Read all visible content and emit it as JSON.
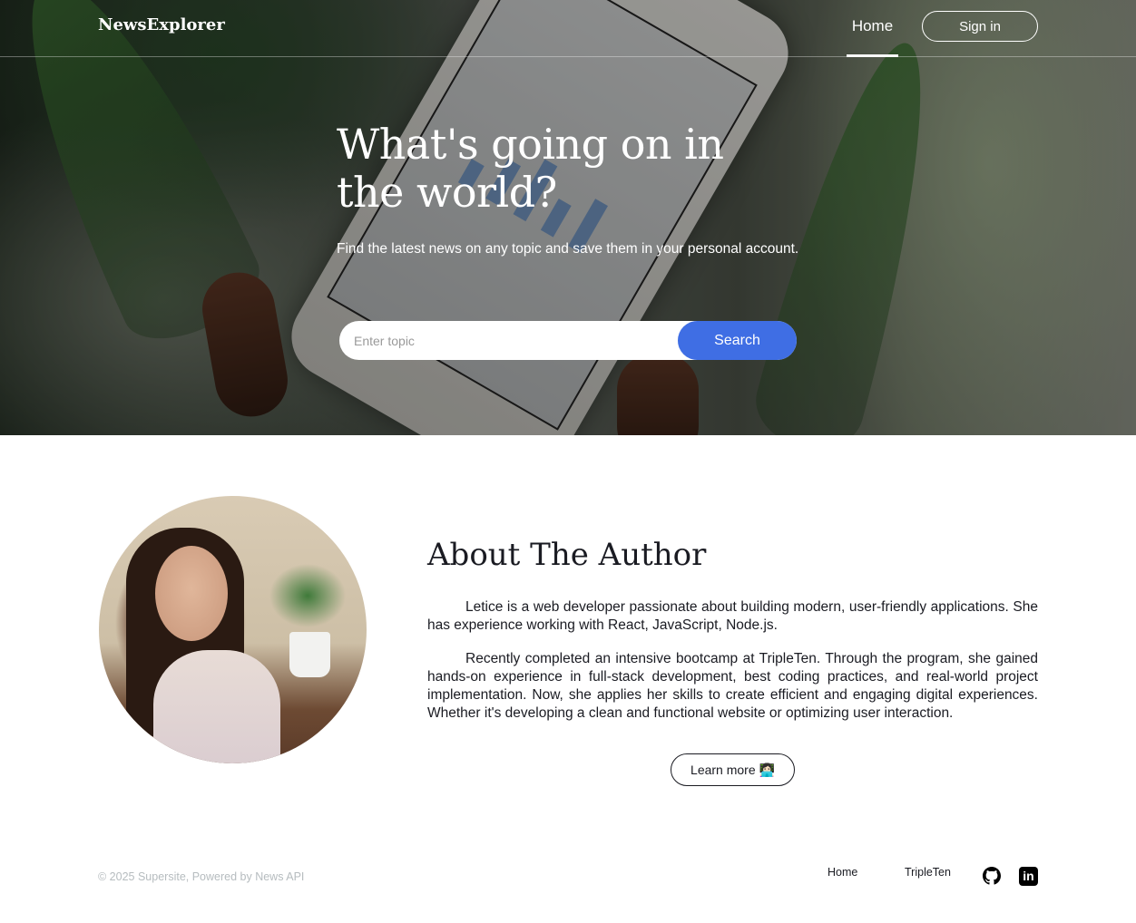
{
  "header": {
    "logo": "NewsExplorer",
    "nav_home": "Home",
    "signin_label": "Sign in"
  },
  "hero": {
    "title": "What's going on in the world?",
    "subtitle": "Find the latest news on any topic and save them in your personal account.",
    "search_placeholder": "Enter topic",
    "search_value": "",
    "search_button": "Search"
  },
  "about": {
    "title": "About The Author",
    "paragraph1": "Letice is a web developer passionate about building modern, user-friendly applications. She has experience working with React, JavaScript, Node.js.",
    "paragraph2": "Recently completed an intensive bootcamp at TripleTen. Through the program, she gained hands-on experience in full-stack development, best coding practices, and real-world project implementation. Now, she applies her skills to create efficient and engaging digital experiences. Whether it's developing a clean and functional website or optimizing user interaction.",
    "learn_more": "Learn more 👩🏻‍💻"
  },
  "footer": {
    "copyright": "© 2025 Supersite, Powered by News API",
    "links": [
      "Home",
      "TripleTen"
    ],
    "icons": [
      "github-icon",
      "linkedin-icon"
    ]
  },
  "colors": {
    "accent": "#3f6ee4",
    "text": "#1a1b22",
    "muted": "#b6bcbf"
  }
}
